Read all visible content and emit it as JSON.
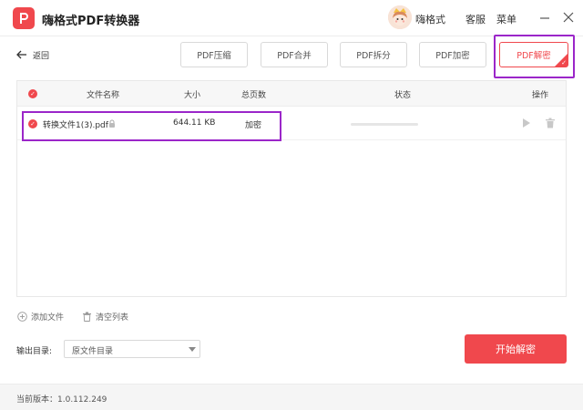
{
  "app": {
    "title": "嗨格式PDF转换器",
    "logo_letter": "P",
    "user_name": "嗨格式",
    "service_label": "客服",
    "menu_label": "菜单"
  },
  "nav": {
    "back_label": "返回"
  },
  "tools": {
    "tabs": [
      {
        "label": "PDF压缩",
        "active": false
      },
      {
        "label": "PDF合并",
        "active": false
      },
      {
        "label": "PDF拆分",
        "active": false
      },
      {
        "label": "PDF加密",
        "active": false
      },
      {
        "label": "PDF解密",
        "active": true
      }
    ]
  },
  "table": {
    "columns": {
      "name": "文件名称",
      "size": "大小",
      "pages": "总页数",
      "status": "状态",
      "actions": "操作"
    },
    "rows": [
      {
        "file_name": "转换文件1(3).pdf",
        "size": "644.11 KB",
        "pages": "加密",
        "progress": 0
      }
    ]
  },
  "list_actions": {
    "add_file": "添加文件",
    "clear_list": "清空列表"
  },
  "output": {
    "label": "输出目录:",
    "selected": "原文件目录"
  },
  "start_button": "开始解密",
  "footer": {
    "version": "当前版本：1.0.112.249"
  },
  "colors": {
    "accent": "#f0484d",
    "highlight": "#9b26c9"
  },
  "icons": [
    "back-arrow-icon",
    "lock-icon",
    "play-icon",
    "trash-icon",
    "plus-circle-icon",
    "minimize-icon",
    "close-icon",
    "check-icon",
    "chevron-down-icon"
  ]
}
